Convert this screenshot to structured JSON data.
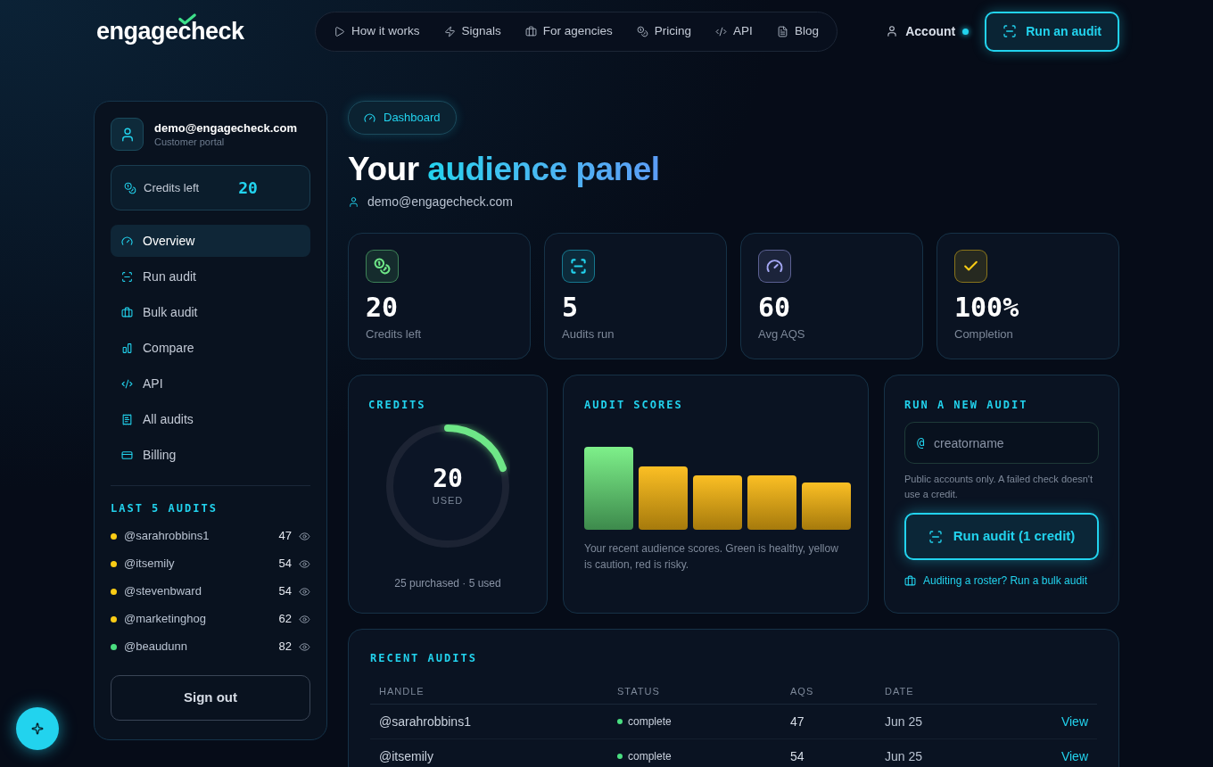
{
  "header": {
    "logo": "engagecheck",
    "nav": [
      {
        "label": "How it works"
      },
      {
        "label": "Signals"
      },
      {
        "label": "For agencies"
      },
      {
        "label": "Pricing"
      },
      {
        "label": "API"
      },
      {
        "label": "Blog"
      }
    ],
    "account": "Account",
    "cta": "Run an audit"
  },
  "sidebar": {
    "email": "demo@engagecheck.com",
    "role": "Customer portal",
    "credits": {
      "label": "Credits left",
      "value": "20"
    },
    "nav": [
      {
        "label": "Overview",
        "selected": true
      },
      {
        "label": "Run audit",
        "selected": false
      },
      {
        "label": "Bulk audit",
        "selected": false
      },
      {
        "label": "Compare",
        "selected": false
      },
      {
        "label": "API",
        "selected": false
      },
      {
        "label": "All audits",
        "selected": false
      },
      {
        "label": "Billing",
        "selected": false
      }
    ],
    "recent_heading": "LAST 5 AUDITS",
    "recent": [
      {
        "handle": "@sarahrobbins1",
        "score": "47",
        "color": "#facc15"
      },
      {
        "handle": "@itsemily",
        "score": "54",
        "color": "#facc15"
      },
      {
        "handle": "@stevenbward",
        "score": "54",
        "color": "#facc15"
      },
      {
        "handle": "@marketinghog",
        "score": "62",
        "color": "#facc15"
      },
      {
        "handle": "@beaudunn",
        "score": "82",
        "color": "#4ade80"
      }
    ],
    "sign_out": "Sign out"
  },
  "main": {
    "badge": "Dashboard",
    "title_lead": "Your",
    "title_highlight": "audience panel",
    "email": "demo@engagecheck.com",
    "stats": [
      {
        "value": "20",
        "label": "Credits left",
        "color": "#6ee787"
      },
      {
        "value": "5",
        "label": "Audits run",
        "color": "#22d3ee"
      },
      {
        "value": "60",
        "label": "Avg AQS",
        "color": "#a5a8f5"
      },
      {
        "value": "100%",
        "label": "Completion",
        "color": "#facc15"
      }
    ],
    "credits": {
      "heading": "CREDITS",
      "value": "20",
      "unit": "USED",
      "level": 0.2,
      "footer": "25 purchased · 5 used"
    },
    "scores": {
      "heading": "AUDIT SCORES",
      "caption": "Your recent audience scores. Green is healthy, yellow is caution, red is risky."
    },
    "new_audit": {
      "heading": "RUN A NEW AUDIT",
      "prefix": "@",
      "placeholder": "creatorname",
      "hint": "Public accounts only. A failed check doesn't use a credit.",
      "button": "Run audit (1 credit)",
      "link": "Auditing a roster? Run a bulk audit"
    },
    "recent_audits": {
      "heading": "RECENT AUDITS",
      "columns": [
        "HANDLE",
        "STATUS",
        "AQS",
        "DATE"
      ],
      "rows": [
        {
          "handle": "@sarahrobbins1",
          "status": "complete",
          "aqs": "47",
          "date": "Jun 25",
          "action": "View"
        },
        {
          "handle": "@itsemily",
          "status": "complete",
          "aqs": "54",
          "date": "Jun 25",
          "action": "View"
        }
      ]
    }
  }
}
